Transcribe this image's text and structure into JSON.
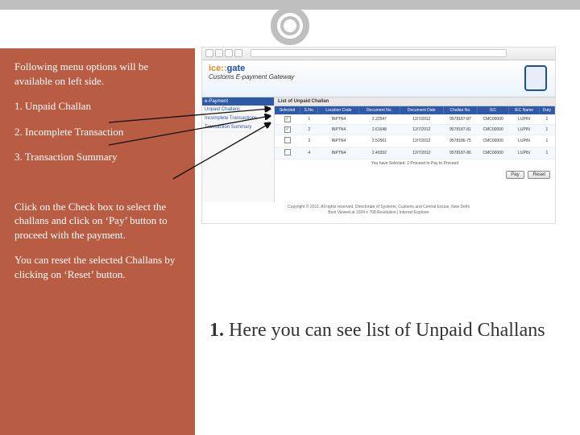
{
  "left": {
    "intro": "Following menu options will be available on left side.",
    "m1": "1. Unpaid Challan",
    "m2": "2. Incomplete Transaction",
    "m3": "3. Transaction Summary",
    "note1": "Click on the Check box to select the challans and click on ‘Pay’ button to proceed with the payment.",
    "note2": "You can reset the selected Challans by clicking on ‘Reset’ button."
  },
  "headline_num": "1.",
  "headline_rest": " Here you can see list of Unpaid Challans",
  "shot": {
    "logo_a": "ice::",
    "logo_b": "gate",
    "subtitle": "Customs E-payment Gateway",
    "side_hdr": "e-Payment",
    "side_items": [
      "Unpaid Challans",
      "Incomplete Transactions",
      "Transaction Summary"
    ],
    "content_hdr": "List of Unpaid Challan",
    "cols": [
      "Selected",
      "S.No.",
      "Location Code",
      "Document No.",
      "Document Date",
      "Challan No.",
      "IEC",
      "IEC Name",
      "Duty"
    ],
    "rows": [
      {
        "chk": true,
        "sno": "1",
        "loc": "INPTN4",
        "doc": "2.22547",
        "date": "12/7/2012",
        "ch": "9578187-87",
        "iec": "CMC00000",
        "name": "LUPIN",
        "duty": "1"
      },
      {
        "chk": true,
        "sno": "2",
        "loc": "INPTN4",
        "doc": "2.61648",
        "date": "12/7/2012",
        "ch": "9578187-81",
        "iec": "CMC00000",
        "name": "LUPIN",
        "duty": "1"
      },
      {
        "chk": false,
        "sno": "3",
        "loc": "INPTN4",
        "doc": "2.52561",
        "date": "12/7/2012",
        "ch": "9578186-75",
        "iec": "CMC00000",
        "name": "LUPIN",
        "duty": "1"
      },
      {
        "chk": false,
        "sno": "4",
        "loc": "INPTN4",
        "doc": "2.40332",
        "date": "12/7/2012",
        "ch": "9578187-86",
        "iec": "CMC00000",
        "name": "LUPIN",
        "duty": "1"
      }
    ],
    "selnote": "You have Selected: 2   Proceed to Pay to Proceed",
    "btn_pay": "Pay",
    "btn_reset": "Reset",
    "footer1": "Copyright © 2011. All rights reserved. Directorate of Systems, Customs and Central Excise, New Delhi",
    "footer2": "Best Viewed at 1024 x 768 Resolution | Internet Explorer"
  }
}
